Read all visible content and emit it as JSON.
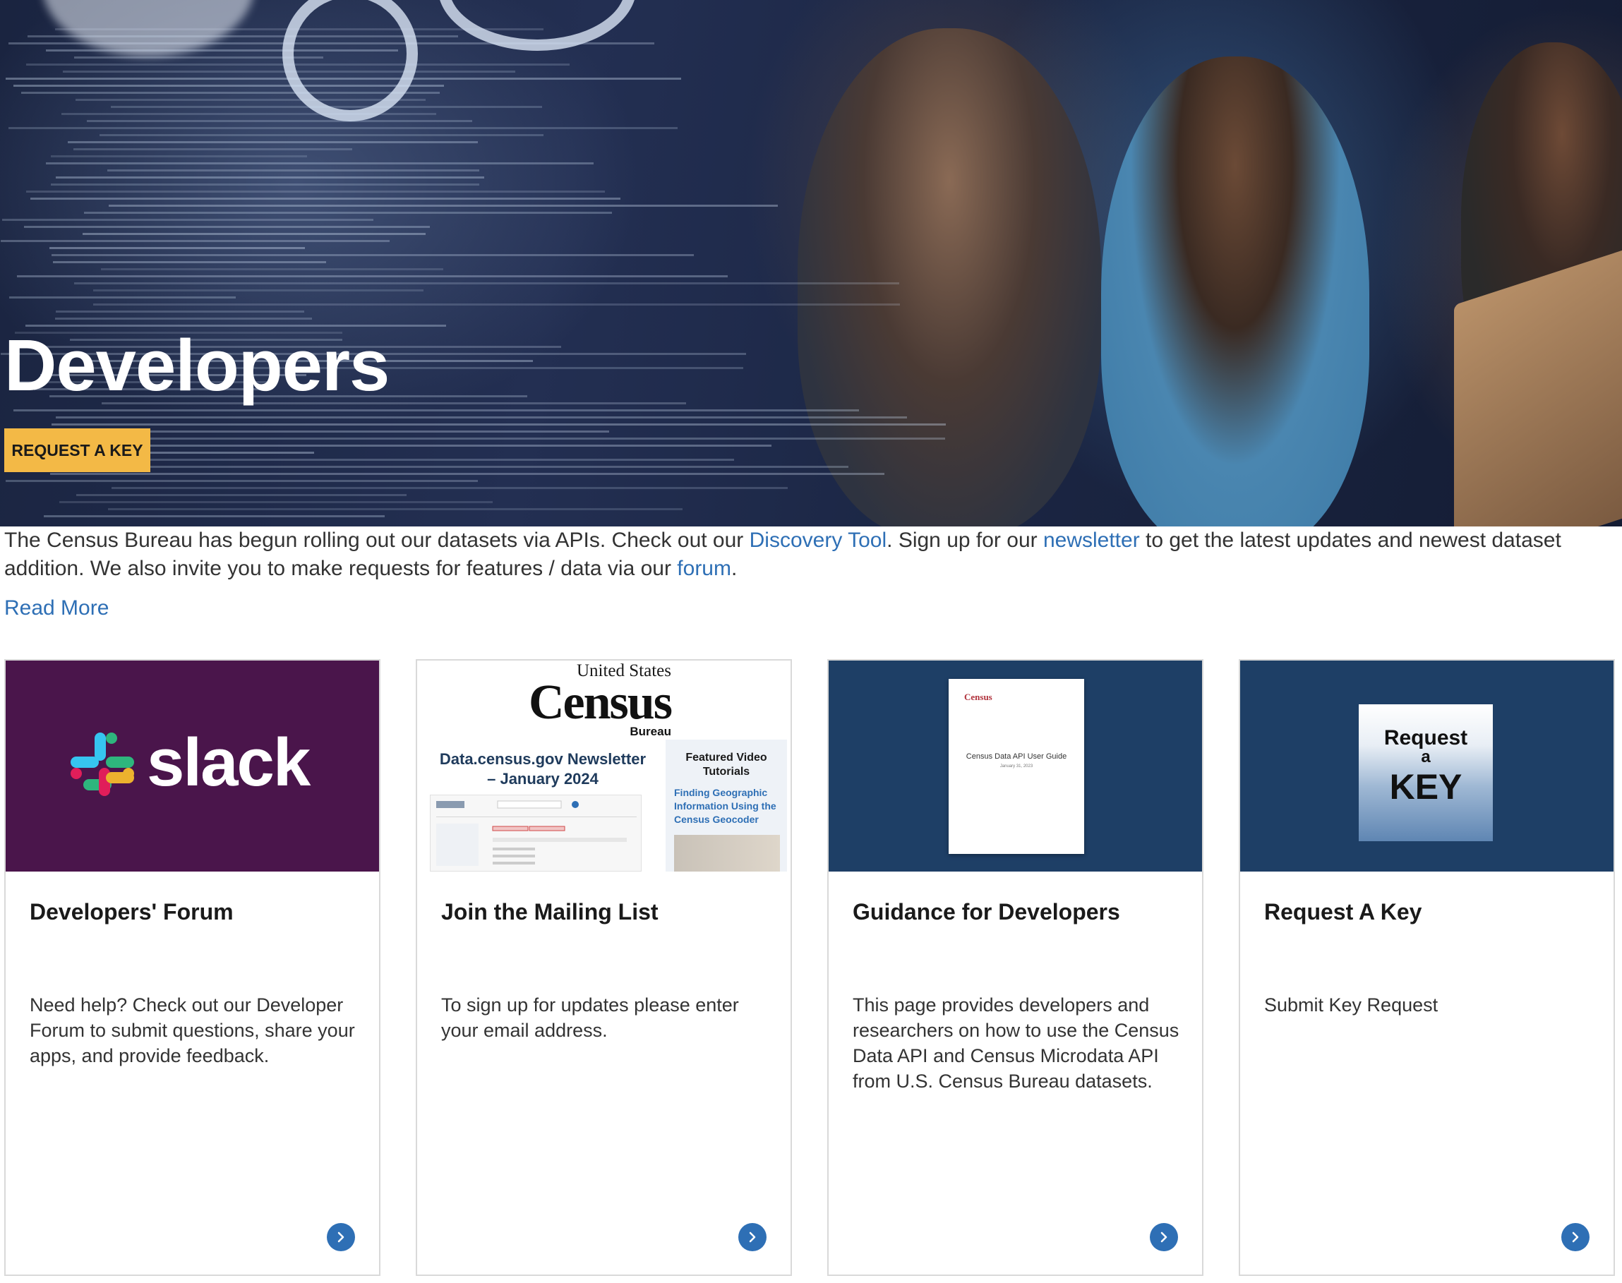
{
  "hero": {
    "title": "Developers",
    "cta_label": "REQUEST A KEY"
  },
  "intro": {
    "text_1": "The Census Bureau has begun rolling out our datasets via APIs.  Check out our ",
    "link_discovery": "Discovery Tool",
    "text_2": ". Sign up for our ",
    "link_newsletter": "newsletter",
    "text_3": " to get the latest updates and newest dataset addition. We also invite you to make requests for features / data via our ",
    "link_forum": "forum",
    "text_4": ".",
    "read_more": "Read More"
  },
  "cards": [
    {
      "title": "Developers' Forum",
      "description": "Need help? Check out our Developer Forum to submit questions, share your apps, and provide feedback.",
      "image": {
        "wordmark": "slack"
      }
    },
    {
      "title": "Join the Mailing List",
      "description": "To sign up for updates please enter your email address.",
      "image": {
        "agency_top": "United States",
        "agency_name": "Census",
        "agency_sub": "Bureau",
        "headline_1": "Data.census.gov Newsletter",
        "headline_2": "– January 2024",
        "side_title": "Featured Video Tutorials",
        "side_link": "Finding Geographic Information Using the Census Geocoder"
      }
    },
    {
      "title": "Guidance for Developers",
      "description": "This page provides developers and researchers on how to use the Census Data API and Census Microdata API from U.S. Census Bureau datasets.",
      "image": {
        "doc_logo": "Census",
        "doc_title": "Census Data API User Guide",
        "doc_date": "January 31, 2023"
      }
    },
    {
      "title": "Request A Key",
      "description": "Submit Key Request",
      "image": {
        "line_1": "Request",
        "line_2": "a",
        "line_3": "KEY"
      }
    }
  ],
  "colors": {
    "accent_yellow": "#f3b946",
    "link_blue": "#2e6fb5",
    "slack_purple": "#4a154b",
    "navy": "#1e3f66"
  },
  "icons": {
    "card_arrow": "chevron-right-icon"
  }
}
